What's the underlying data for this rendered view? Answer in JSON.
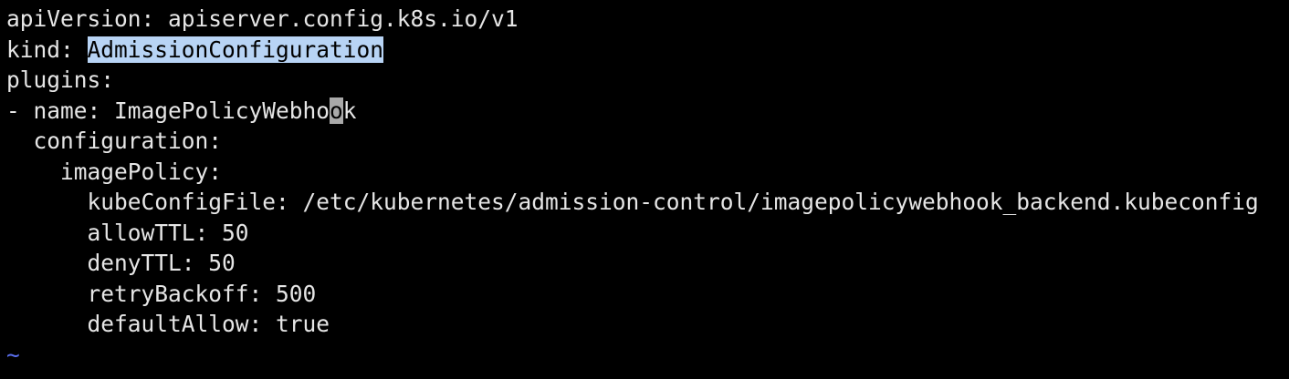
{
  "colors": {
    "background": "#000000",
    "foreground": "#e6e6e6",
    "selection": "#b8d4f5",
    "cursor": "#a9a9a9",
    "tilde": "#5a6ff0"
  },
  "editor": {
    "lines": [
      "apiVersion: apiserver.config.k8s.io/v1",
      "plugins:",
      "  configuration:",
      "    imagePolicy:",
      "      kubeConfigFile: /etc/kubernetes/admission-control/imagepolicywebhook_backend.kubeconfig",
      "      allowTTL: 50",
      "      denyTTL: 50",
      "      retryBackoff: 500",
      "      defaultAllow: true"
    ],
    "kind_line": {
      "prefix": "kind: ",
      "selected": "AdmissionConfiguration"
    },
    "name_line": {
      "before_cursor": "- name: ImagePolicyWebho",
      "cursor_char": "o",
      "after_cursor": "k"
    },
    "empty_line_marker": "~"
  }
}
